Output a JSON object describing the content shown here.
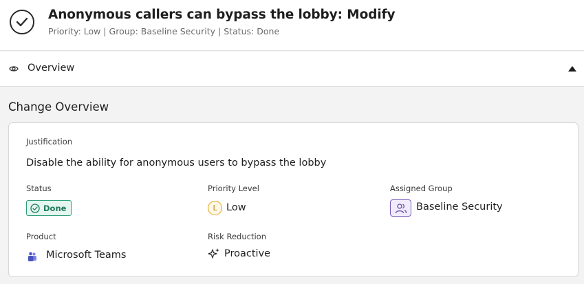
{
  "header": {
    "title": "Anonymous callers can bypass the lobby: Modify",
    "subtitle": "Priority: Low | Group: Baseline Security | Status: Done",
    "icon": "check-circle-icon"
  },
  "overview": {
    "label": "Overview",
    "icon": "eye-icon",
    "toggle_icon": "caret-up-icon"
  },
  "change_overview": {
    "title": "Change Overview",
    "justification": {
      "label": "Justification",
      "value": "Disable the ability for anonymous users to bypass the lobby"
    },
    "status": {
      "label": "Status",
      "value": "Done",
      "color": "#2f9e7a"
    },
    "priority": {
      "label": "Priority Level",
      "value": "Low",
      "badge": "L",
      "color": "#e0a51e"
    },
    "group": {
      "label": "Assigned Group",
      "value": "Baseline Security",
      "color": "#7a5cc0"
    },
    "product": {
      "label": "Product",
      "value": "Microsoft Teams",
      "icon": "teams-icon"
    },
    "risk": {
      "label": "Risk Reduction",
      "value": "Proactive",
      "icon": "sparkle-icon"
    }
  }
}
